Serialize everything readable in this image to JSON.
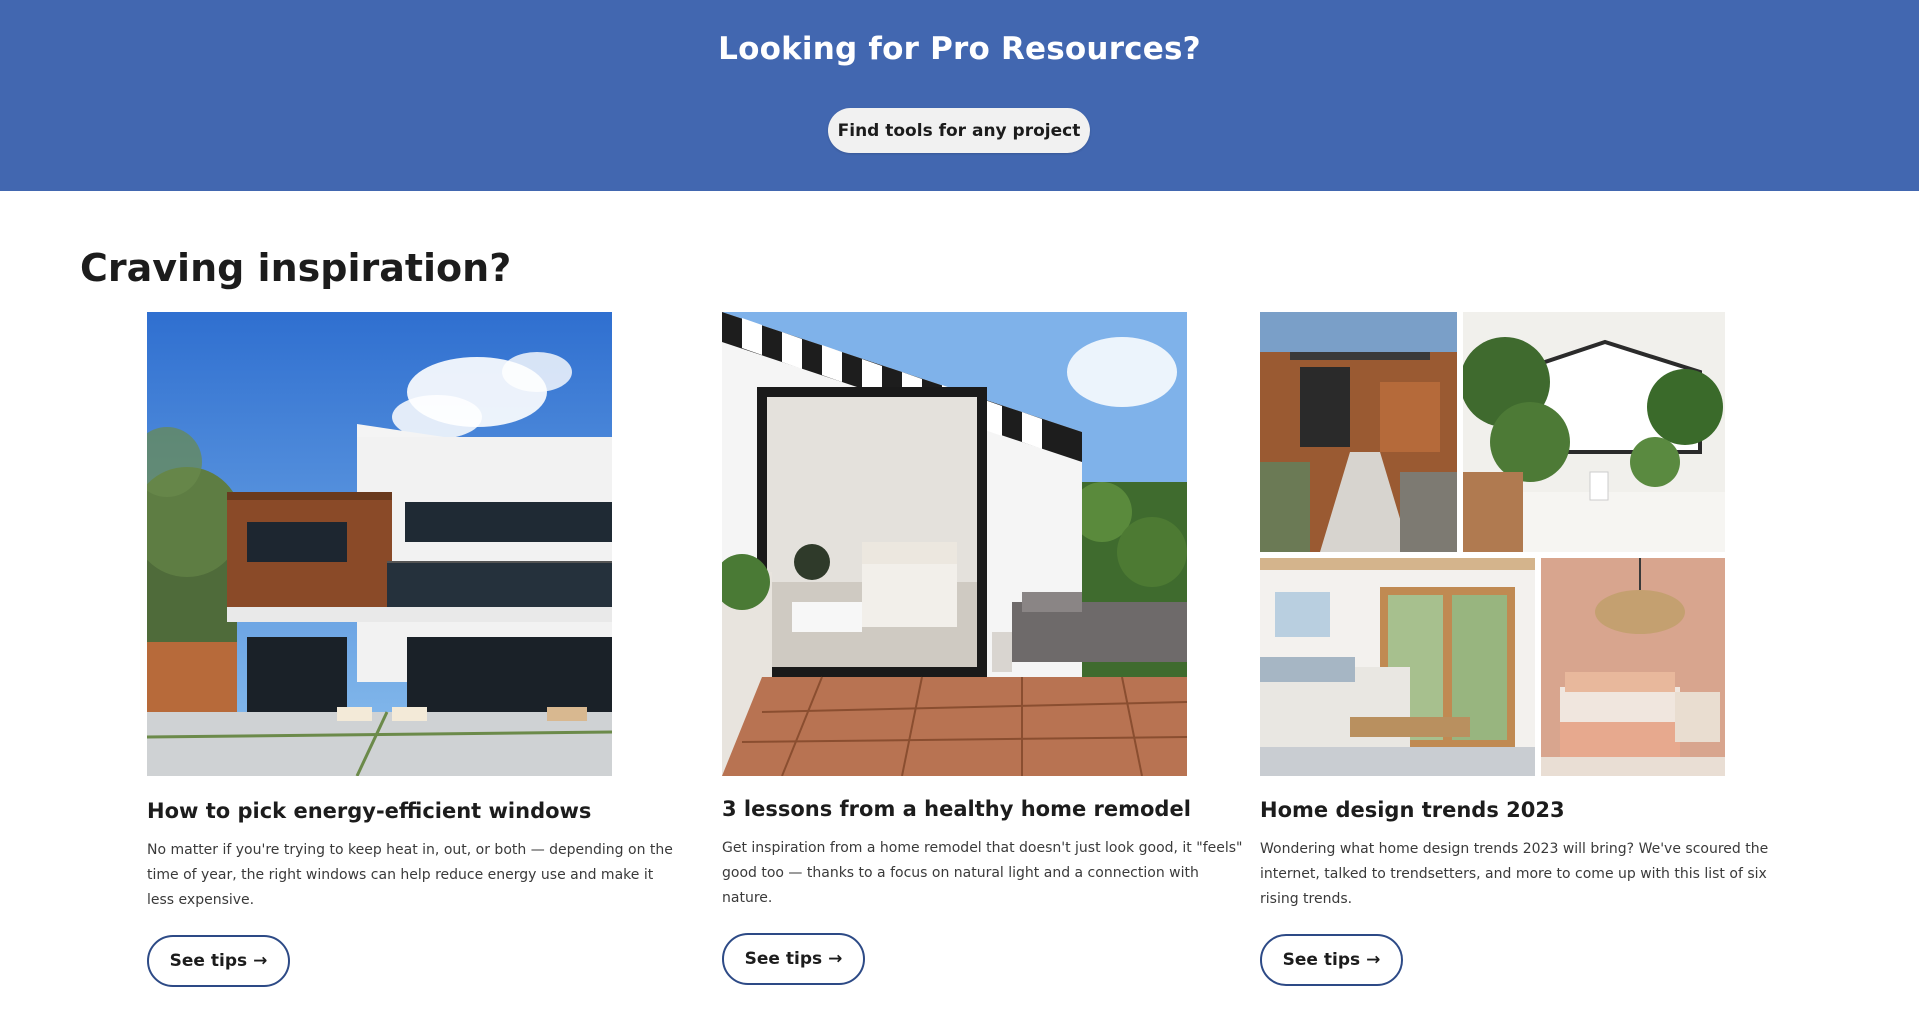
{
  "banner": {
    "title": "Looking for Pro Resources?",
    "button_label": "Find tools for any project",
    "background": "#4267b0"
  },
  "section": {
    "title": "Craving inspiration?"
  },
  "cards": [
    {
      "title": "How to pick energy-efficient windows",
      "body": "No matter if you're trying to keep heat in, out, or both — depending on the time of year, the right windows can help reduce energy use and make it less expensive.",
      "button_label": "See tips",
      "button_arrow": "→",
      "image": "modern-house-exterior"
    },
    {
      "title": "3 lessons from a healthy home remodel",
      "body": "Get inspiration from a home remodel that doesn't just look good, it \"feels\" good too — thanks to a focus on natural light and a connection with nature.",
      "button_label": "See tips",
      "button_arrow": "→",
      "image": "bedroom-patio-remodel"
    },
    {
      "title": "Home design trends 2023",
      "body": "Wondering what home design trends 2023 will bring? We've scoured the internet, talked to trendsetters, and more to come up with this list of six rising trends.",
      "button_label": "See tips",
      "button_arrow": "→",
      "image": "design-trends-collage"
    }
  ]
}
